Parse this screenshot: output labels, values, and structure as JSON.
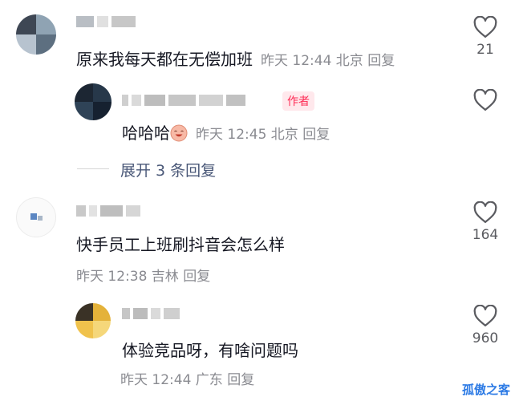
{
  "comments": [
    {
      "text": "原来我每天都在无偿加班",
      "meta": "昨天 12:44 北京 回复",
      "likes": "21"
    },
    {
      "text": "哈哈哈",
      "meta": "昨天 12:45 北京 回复",
      "author_tag": "作者",
      "emoji_icon": "laughing-face-emoji"
    },
    {
      "text": "快手员工上班刷抖音会怎么样",
      "meta": "昨天 12:38 吉林 回复",
      "likes": "164"
    },
    {
      "text": "体验竞品呀，有啥问题吗",
      "meta": "昨天 12:44 广东 回复",
      "likes": "960"
    }
  ],
  "expand_replies": "展开 3 条回复",
  "watermark": "孤傲之客",
  "colors": {
    "text": "#161823",
    "meta": "#8a8b91",
    "author_tag": "#fe2c55",
    "expand": "#4a5878",
    "watermark": "#2d7be5"
  },
  "icons": [
    "heart-outline-icon"
  ]
}
